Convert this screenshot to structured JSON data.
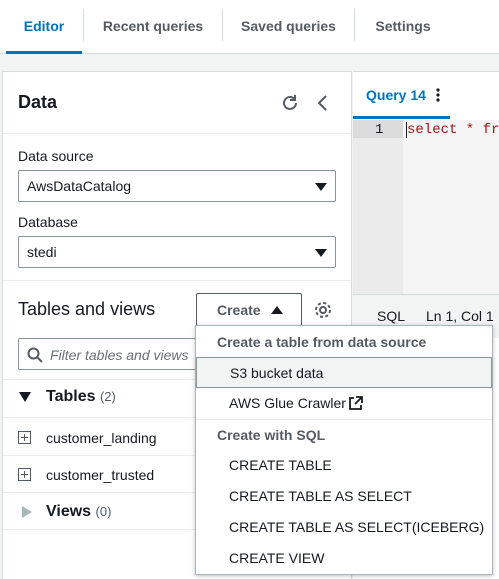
{
  "tabs": [
    {
      "label": "Editor",
      "active": true
    },
    {
      "label": "Recent queries",
      "active": false
    },
    {
      "label": "Saved queries",
      "active": false
    },
    {
      "label": "Settings",
      "active": false
    }
  ],
  "panel": {
    "title": "Data",
    "refresh_icon": "refresh-icon",
    "collapse_icon": "chevron-left-icon"
  },
  "data_source": {
    "label": "Data source",
    "value": "AwsDataCatalog"
  },
  "database": {
    "label": "Database",
    "value": "stedi"
  },
  "tables_views": {
    "title": "Tables and views",
    "create_label": "Create",
    "settings_icon": "gear-icon",
    "filter_placeholder": "Filter tables and views"
  },
  "tables": {
    "title": "Tables",
    "count": "(2)",
    "items": [
      "customer_landing",
      "customer_trusted"
    ]
  },
  "views": {
    "title": "Views",
    "count": "(0)"
  },
  "editor": {
    "query_tab": "Query 14",
    "line_number": "1",
    "code": "select * fr",
    "language": "SQL",
    "cursor": "Ln 1, Col 1"
  },
  "create_menu": {
    "group1": "Create a table from data source",
    "item_s3": "S3 bucket data",
    "item_glue": "AWS Glue Crawler",
    "group2": "Create with SQL",
    "sql_items": [
      "CREATE TABLE",
      "CREATE TABLE AS SELECT",
      "CREATE TABLE AS SELECT(ICEBERG)",
      "CREATE VIEW"
    ]
  },
  "colors": {
    "accent": "#0073bb",
    "text": "#16191f",
    "muted": "#545b64"
  }
}
